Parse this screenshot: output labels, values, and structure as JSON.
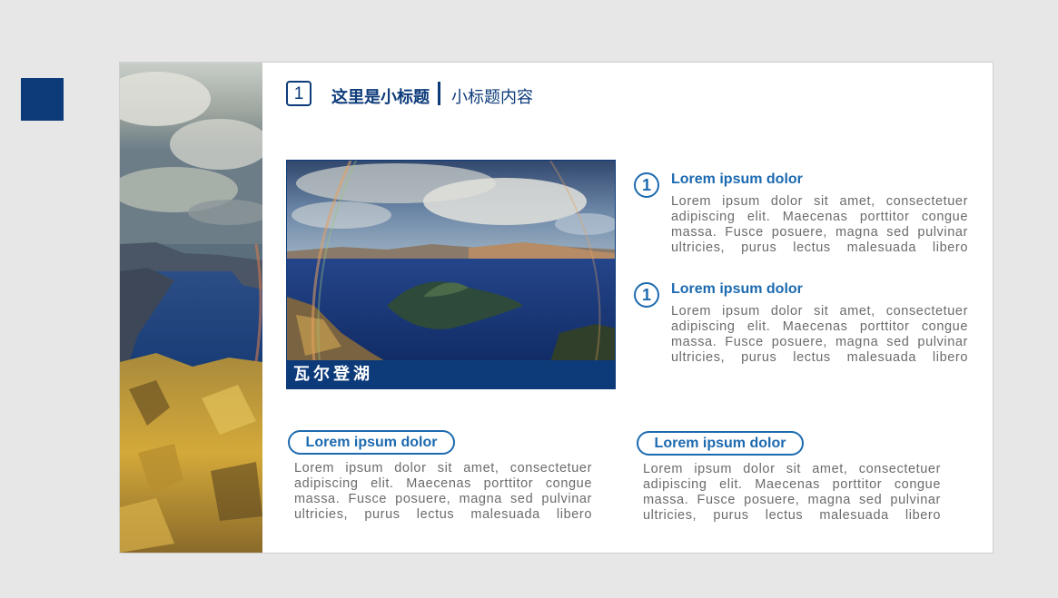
{
  "header": {
    "number": "1",
    "title": "这里是小标题",
    "subtitle": "小标题内容"
  },
  "photo": {
    "caption": "瓦尔登湖"
  },
  "right_items": [
    {
      "number": "1",
      "title": "Lorem ipsum dolor",
      "lines": [
        "Lorem ipsum dolor sit amet, consectetuer",
        "adipiscing elit. Maecenas porttitor congue",
        "massa. Fusce posuere, magna sed pulvinar",
        "ultricies, purus lectus malesuada libero"
      ]
    },
    {
      "number": "1",
      "title": "Lorem ipsum dolor",
      "lines": [
        "Lorem ipsum dolor sit amet, consectetuer",
        "adipiscing elit. Maecenas porttitor congue",
        "massa. Fusce posuere, magna sed pulvinar",
        "ultricies, purus lectus malesuada libero"
      ]
    }
  ],
  "bottom_items": [
    {
      "title": "Lorem ipsum dolor",
      "lines": [
        "Lorem ipsum dolor sit amet, consectetuer",
        "adipiscing elit. Maecenas porttitor congue",
        "massa. Fusce posuere, magna sed pulvinar",
        "ultricies, purus lectus malesuada libero"
      ]
    },
    {
      "title": "Lorem ipsum dolor",
      "lines": [
        "Lorem ipsum dolor sit amet, consectetuer",
        "adipiscing elit. Maecenas porttitor congue",
        "massa. Fusce posuere, magna sed pulvinar",
        "ultricies, purus lectus malesuada libero"
      ]
    }
  ],
  "colors": {
    "primary": "#0d3b7a",
    "accent": "#1c6ab0",
    "body_text": "#6b6b6b"
  }
}
